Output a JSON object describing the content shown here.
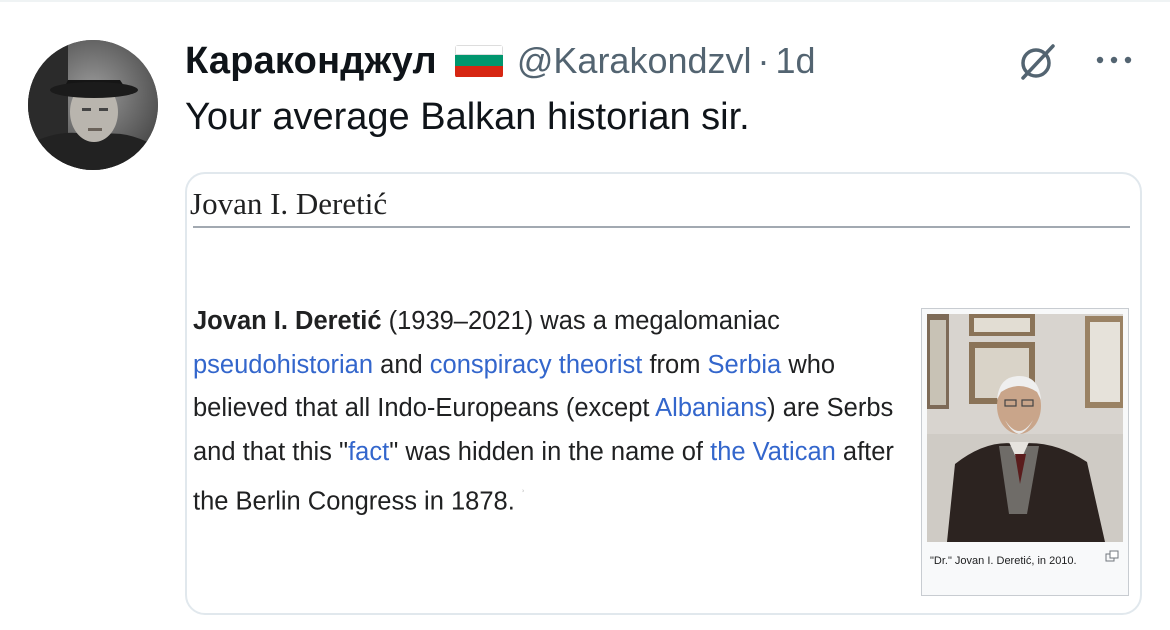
{
  "tweet": {
    "display_name": "Караконджул",
    "flag_icon": "bulgaria-flag-icon",
    "handle": "@Karakondzvl",
    "separator": "·",
    "time": "1d",
    "text": "Your average Balkan historian sir.",
    "actions": {
      "grok_icon": "grok-icon",
      "more_icon": "more-horizontal-icon"
    }
  },
  "card": {
    "title": "Jovan I. Deretić",
    "paragraph": {
      "name": "Jovan I. Deretić",
      "t1": " (1939–2021) was a megalomaniac ",
      "link1": "pseudohistorian",
      "t2": " and ",
      "link2": "conspiracy theorist",
      "t3": " from ",
      "link3": "Serbia",
      "t4": " who believed that all Indo-Europeans (except ",
      "link4": "Albanians",
      "t5": ") are Serbs and that this \"",
      "link5": "fact",
      "t6": "\" was hidden in the name of ",
      "link6": "the Vatican",
      "t7": " after the Berlin Congress in 1878."
    },
    "image_caption": "\"Dr.\" Jovan I. Deretić, in 2010.",
    "link_color": "#3366cc"
  }
}
